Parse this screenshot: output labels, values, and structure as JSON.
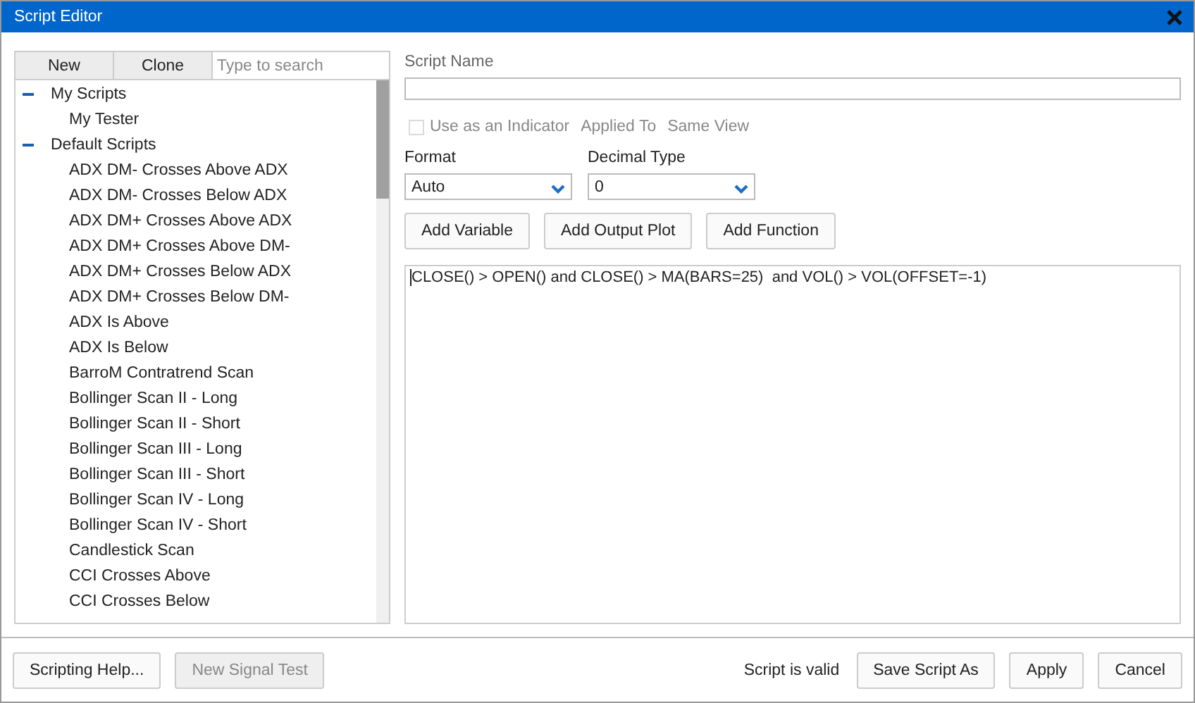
{
  "window": {
    "title": "Script Editor"
  },
  "sidebar": {
    "buttons": [
      "New",
      "Clone"
    ],
    "search": {
      "placeholder": "Type to search"
    },
    "tree": [
      {
        "label": "My Scripts",
        "expanded": true,
        "children": [
          {
            "label": "My Tester"
          }
        ]
      },
      {
        "label": "Default Scripts",
        "expanded": true,
        "children": [
          {
            "label": "ADX DM- Crosses Above ADX"
          },
          {
            "label": "ADX DM- Crosses Below ADX"
          },
          {
            "label": "ADX DM+ Crosses Above ADX"
          },
          {
            "label": "ADX DM+ Crosses Above DM-"
          },
          {
            "label": "ADX DM+ Crosses Below ADX"
          },
          {
            "label": "ADX DM+ Crosses Below DM-"
          },
          {
            "label": "ADX Is Above"
          },
          {
            "label": "ADX Is Below"
          },
          {
            "label": "BarroM Contratrend Scan"
          },
          {
            "label": "Bollinger Scan II - Long"
          },
          {
            "label": "Bollinger Scan II - Short"
          },
          {
            "label": "Bollinger Scan III - Long"
          },
          {
            "label": "Bollinger Scan III - Short"
          },
          {
            "label": "Bollinger Scan IV - Long"
          },
          {
            "label": "Bollinger Scan IV - Short"
          },
          {
            "label": "Candlestick Scan"
          },
          {
            "label": "CCI Crosses Above"
          },
          {
            "label": "CCI Crosses Below"
          }
        ]
      }
    ]
  },
  "editor": {
    "script_name_label": "Script Name",
    "indicator": {
      "label": "Use as an Indicator",
      "checked": false,
      "disabled": true
    },
    "applied_to_label": "Applied To",
    "applied_to_value": "Same View",
    "format": {
      "label": "Format",
      "value": "Auto"
    },
    "decimal_type": {
      "label": "Decimal Type",
      "value": "0"
    },
    "buttons": [
      "Add Variable",
      "Add Output Plot",
      "Add Function"
    ],
    "code": "CLOSE() > OPEN() and CLOSE() > MA(BARS=25)  and VOL() > VOL(OFFSET=-1)"
  },
  "footer": {
    "left_buttons": [
      {
        "label": "Scripting Help...",
        "disabled": false
      },
      {
        "label": "New Signal Test",
        "disabled": true
      }
    ],
    "status": "Script is valid",
    "right_buttons": [
      "Save Script As",
      "Apply",
      "Cancel"
    ]
  }
}
